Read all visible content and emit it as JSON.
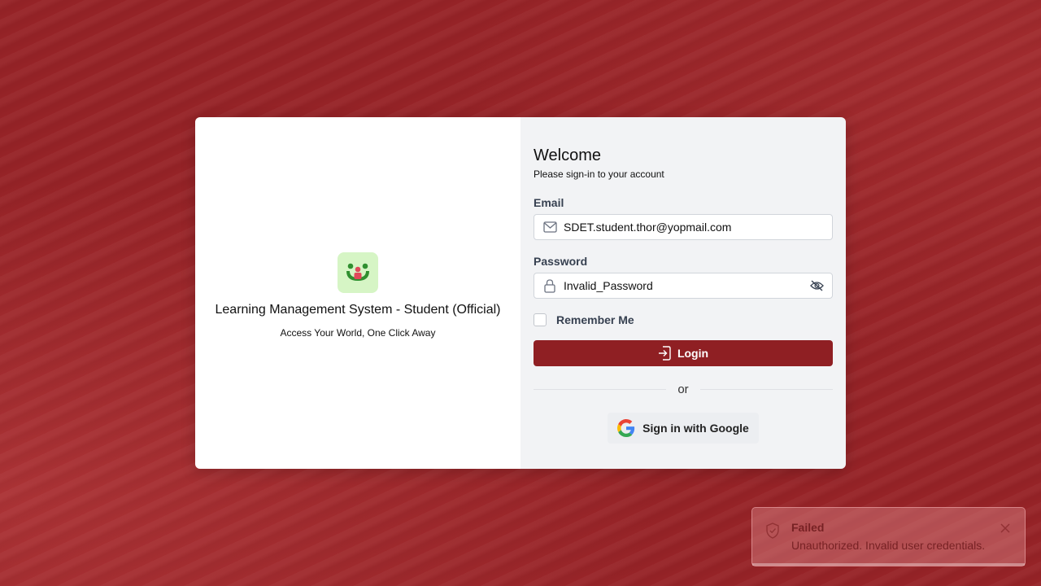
{
  "app": {
    "title": "Learning Management System - Student (Official)",
    "subtitle": "Access Your World, One Click Away"
  },
  "login": {
    "welcome": "Welcome",
    "subtitle": "Please sign-in to your account",
    "email_label": "Email",
    "email_value": "SDET.student.thor@yopmail.com",
    "password_label": "Password",
    "password_value": "Invalid_Password",
    "remember_label": "Remember Me",
    "remember_checked": false,
    "login_label": "Login",
    "divider_text": "or",
    "google_label": "Sign in with Google"
  },
  "toast": {
    "title": "Failed",
    "message": "Unauthorized. Invalid user credentials."
  },
  "colors": {
    "brand": "#8f1f23",
    "background": "#962327",
    "logo_bg": "#d6f5c5"
  },
  "icons": {
    "email": "envelope-icon",
    "password": "lock-icon",
    "toggle_password": "eye-slash-icon",
    "login": "sign-in-icon",
    "google": "google-icon",
    "toast": "shield-icon",
    "toast_close": "close-icon"
  }
}
